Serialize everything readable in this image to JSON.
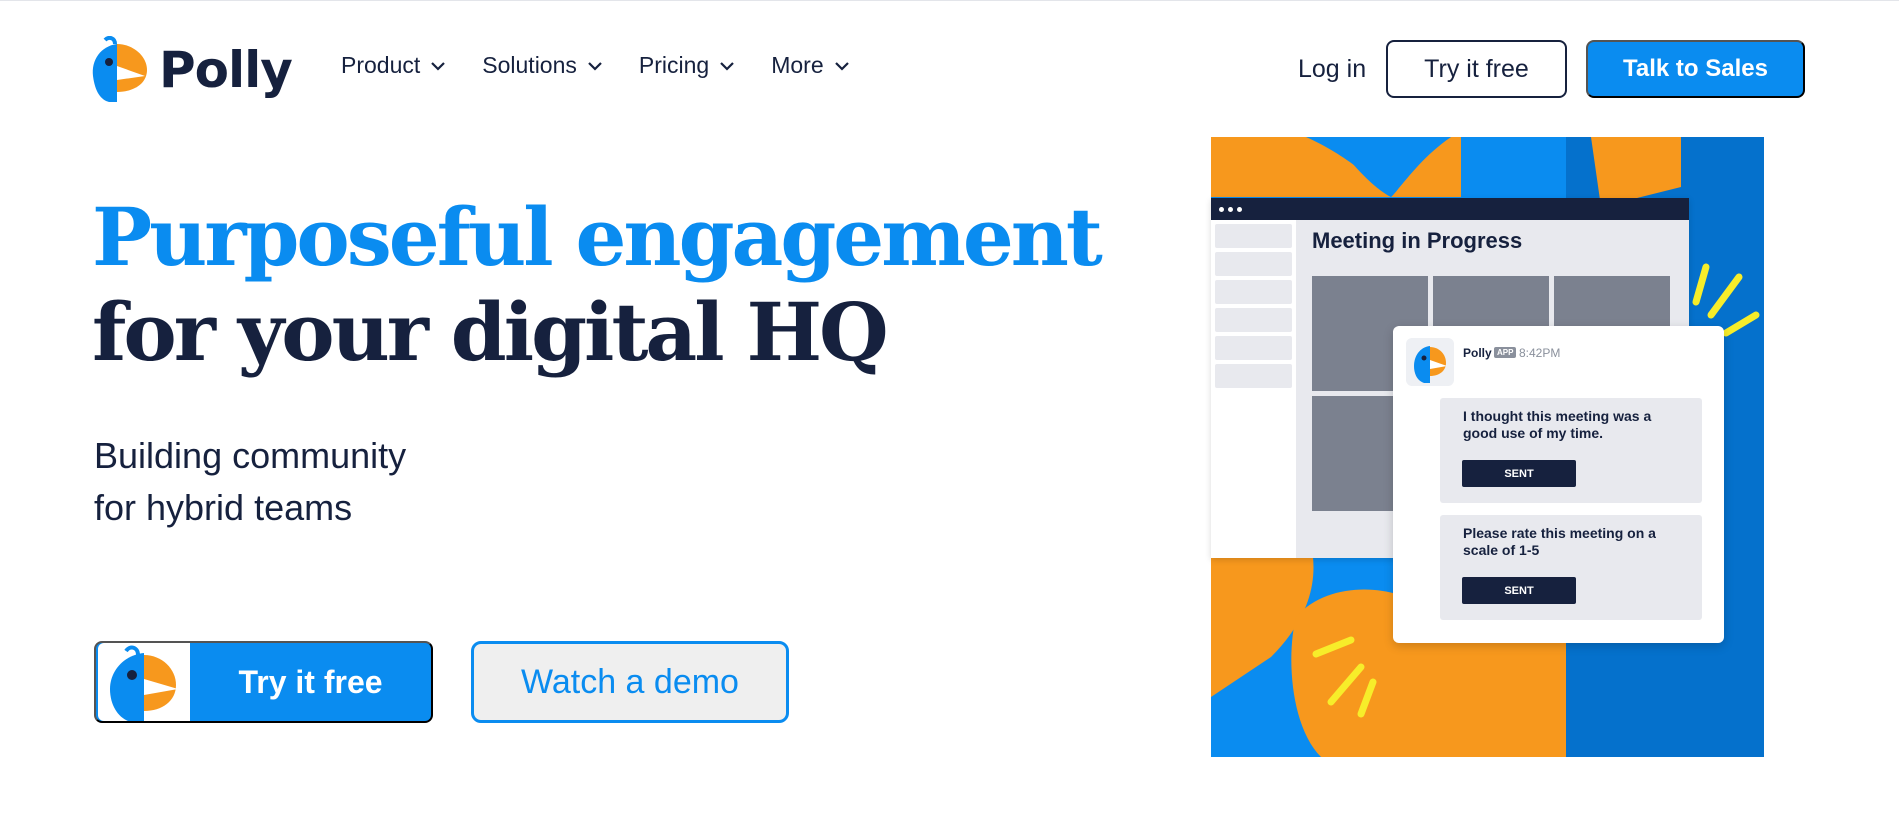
{
  "brand": {
    "name": "Polly",
    "blue": "#0a8cf0",
    "orange": "#f7981d",
    "navy": "#16213e",
    "logo_icon": "parrot-logo-icon"
  },
  "nav": {
    "items": [
      {
        "label": "Product",
        "icon": "chevron-down-icon"
      },
      {
        "label": "Solutions",
        "icon": "chevron-down-icon"
      },
      {
        "label": "Pricing",
        "icon": "chevron-down-icon"
      },
      {
        "label": "More",
        "icon": "chevron-down-icon"
      }
    ],
    "login": "Log in",
    "try_free": "Try it free",
    "talk_sales": "Talk to Sales"
  },
  "hero": {
    "headline_line1": "Purposeful engagement",
    "headline_line2": "for your digital HQ",
    "sub_line1": "Building community",
    "sub_line2": "for hybrid teams",
    "cta_primary": "Try it free",
    "cta_secondary": "Watch a demo"
  },
  "illustration": {
    "window_title": "Meeting in Progress",
    "message": {
      "sender": "Polly",
      "badge": "APP",
      "time": "8:42PM",
      "blocks": [
        {
          "text": "I thought this meeting was a good use of my time.",
          "button": "SENT"
        },
        {
          "text": "Please rate this meeting on a scale of 1-5",
          "button": "SENT"
        }
      ]
    }
  }
}
